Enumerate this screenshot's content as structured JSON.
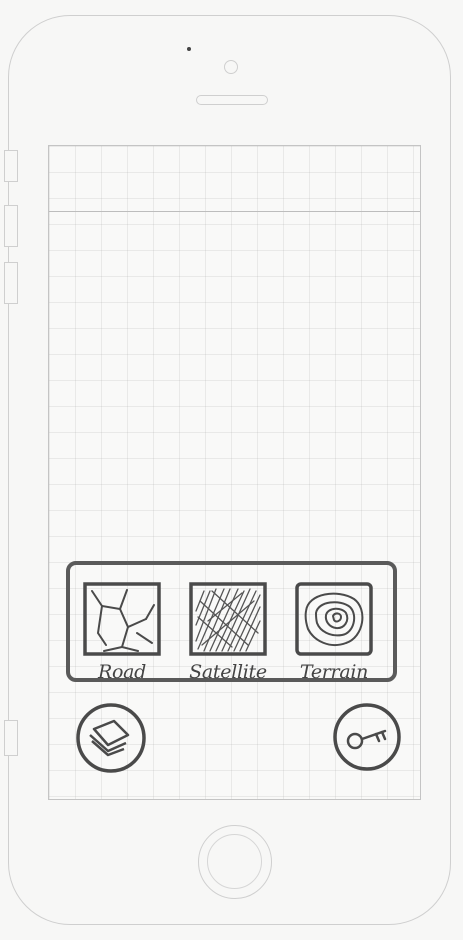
{
  "map_types": [
    {
      "label": "Road",
      "icon": "road-map-icon"
    },
    {
      "label": "Satellite",
      "icon": "satellite-map-icon"
    },
    {
      "label": "Terrain",
      "icon": "terrain-map-icon"
    }
  ],
  "buttons": {
    "left_icon": "layers-icon",
    "right_icon": "key-icon"
  },
  "colors": {
    "ink": "#4a4a4a",
    "outline": "#cfcfcf"
  }
}
